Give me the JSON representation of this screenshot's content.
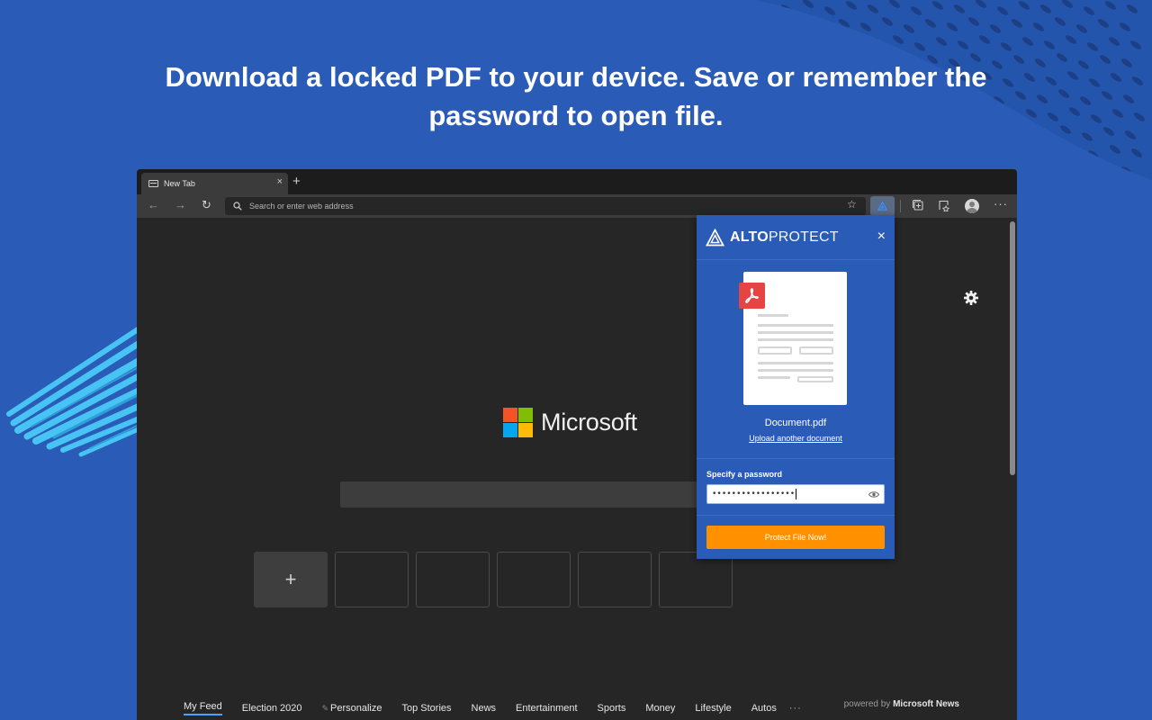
{
  "headline": {
    "line1": "Download a locked PDF to your device. Save or remember the",
    "line2": "password to open file."
  },
  "browser": {
    "tab": {
      "title": "New Tab",
      "close_glyph": "×"
    },
    "new_tab_glyph": "+",
    "address": {
      "placeholder": "Search or enter web address"
    },
    "back_glyph": "←",
    "forward_glyph": "→",
    "refresh_glyph": "↻",
    "favorite_glyph": "☆",
    "more_glyph": "···"
  },
  "newtab": {
    "brand": "Microsoft",
    "add_tile_glyph": "+",
    "feed": {
      "items": [
        "My Feed",
        "Election 2020",
        "Personalize",
        "Top Stories",
        "News",
        "Entertainment",
        "Sports",
        "Money",
        "Lifestyle",
        "Autos"
      ],
      "more_glyph": "···",
      "powered_prefix": "powered by",
      "powered_brand": "Microsoft News"
    }
  },
  "popup": {
    "brand_bold": "ALTO",
    "brand_light": "PROTECT",
    "close_glyph": "×",
    "document_name": "Document.pdf",
    "upload_link": "Upload another document",
    "password_label": "Specify a password",
    "password_value": "•••••••••••••••••",
    "submit_label": "Protect File Now!"
  },
  "colors": {
    "background": "#2a5bb6",
    "accent": "#ff9100",
    "pdf_red": "#e64343"
  }
}
